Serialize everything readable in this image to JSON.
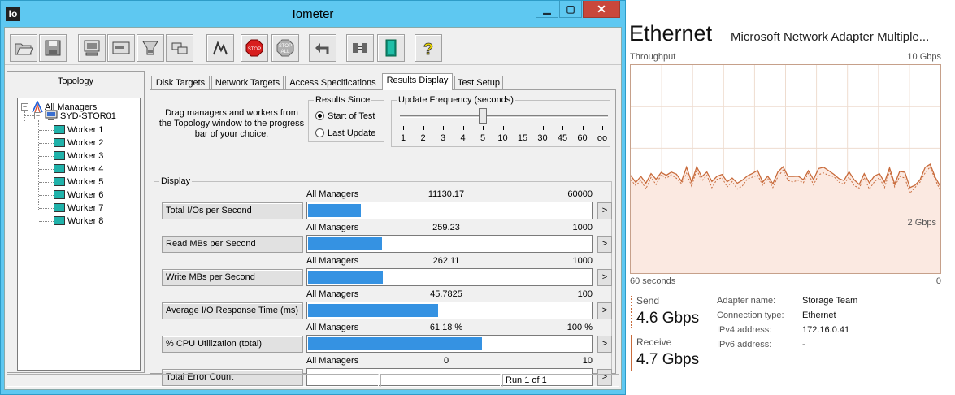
{
  "window": {
    "title": "Iometer",
    "icon_text": "Io",
    "controls": {
      "minimize": "▁",
      "maximize": "▢",
      "close": "✕"
    }
  },
  "toolbar": {
    "buttons": [
      "open-icon",
      "save-icon",
      "start-display-icon",
      "new-manager-icon",
      "new-worker-icon",
      "duplicate-worker-icon",
      "graph-icon",
      "stop-icon",
      "stop-all-icon",
      "reset-icon",
      "disconnect-icon",
      "exit-icon",
      "help-icon"
    ],
    "stop_label": "STOP",
    "stop_all_label_1": "STOP",
    "stop_all_label_2": "ALL",
    "help_label": "?"
  },
  "topology": {
    "title": "Topology",
    "root": "All Managers",
    "manager": "SYD-STOR01",
    "workers": [
      "Worker 1",
      "Worker 2",
      "Worker 3",
      "Worker 4",
      "Worker 5",
      "Worker 6",
      "Worker 7",
      "Worker 8"
    ],
    "expander": "−"
  },
  "tabs": [
    "Disk Targets",
    "Network Targets",
    "Access Specifications",
    "Results Display",
    "Test Setup"
  ],
  "active_tab": "Results Display",
  "results": {
    "hint": "Drag managers and workers from the Topology window to the progress bar of your choice.",
    "since": {
      "label": "Results Since",
      "options": [
        "Start of Test",
        "Last Update"
      ],
      "selected": "Start of Test"
    },
    "update_freq": {
      "label": "Update Frequency (seconds)",
      "ticks": [
        "1",
        "2",
        "3",
        "4",
        "5",
        "10",
        "15",
        "30",
        "45",
        "60",
        "oo"
      ],
      "selected_index": 4
    },
    "display_label": "Display",
    "arrow": ">",
    "rows": [
      {
        "button": "Total I/Os per Second",
        "manager": "All Managers",
        "value": "11130.17",
        "max": "60000",
        "fraction": 0.1855
      },
      {
        "button": "Read MBs per Second",
        "manager": "All Managers",
        "value": "259.23",
        "max": "1000",
        "fraction": 0.2592
      },
      {
        "button": "Write MBs per Second",
        "manager": "All Managers",
        "value": "262.11",
        "max": "1000",
        "fraction": 0.2621
      },
      {
        "button": "Average I/O Response Time (ms)",
        "manager": "All Managers",
        "value": "45.7825",
        "max": "100",
        "fraction": 0.4578
      },
      {
        "button": "% CPU Utilization (total)",
        "manager": "All Managers",
        "value": "61.18 %",
        "max": "100 %",
        "fraction": 0.6118
      },
      {
        "button": "Total Error Count",
        "manager": "All Managers",
        "value": "0",
        "max": "10",
        "fraction": 0
      }
    ]
  },
  "status": {
    "run": "Run 1 of 1"
  },
  "ethernet": {
    "title": "Ethernet",
    "adapter": "Microsoft Network Adapter Multiple...",
    "throughput_label": "Throughput",
    "max_label": "10 Gbps",
    "mid_label": "2 Gbps",
    "time_left": "60 seconds",
    "time_right": "0",
    "send_label": "Send",
    "send_value": "4.6 Gbps",
    "receive_label": "Receive",
    "receive_value": "4.7 Gbps",
    "details": [
      {
        "key": "Adapter name:",
        "value": "Storage Team"
      },
      {
        "key": "Connection type:",
        "value": "Ethernet"
      },
      {
        "key": "IPv4 address:",
        "value": "172.16.0.41"
      },
      {
        "key": "IPv6 address:",
        "value": "-"
      }
    ],
    "colors": {
      "line": "#c86a3a",
      "fill": "#fbe9e1",
      "grid": "#eedccf",
      "border": "#c6a08a"
    }
  }
}
